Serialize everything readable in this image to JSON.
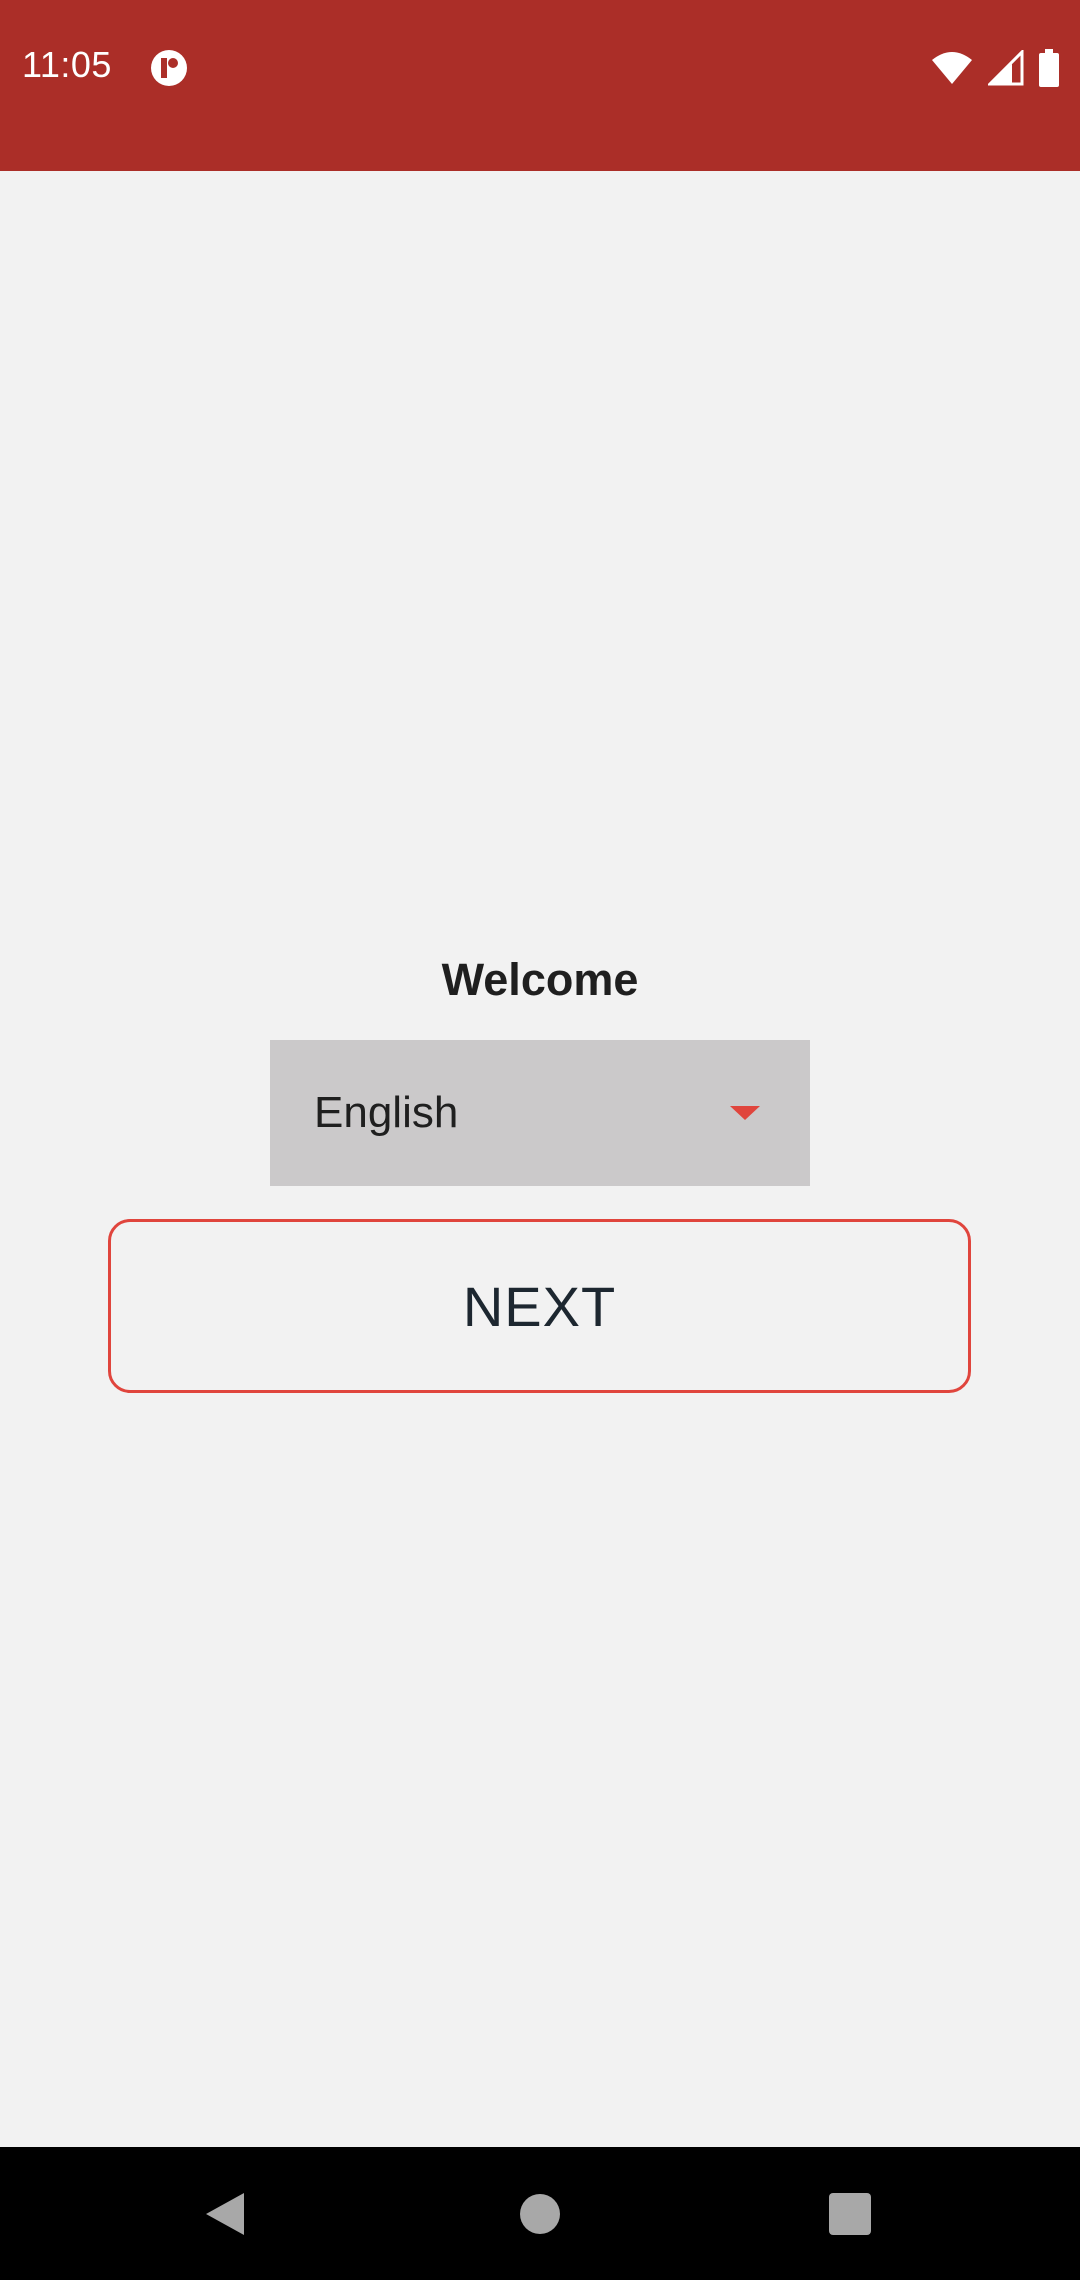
{
  "status_bar": {
    "time": "11:05",
    "app_icon": "app-notification-icon",
    "icons": [
      "wifi-icon",
      "cell-signal-icon",
      "battery-icon"
    ],
    "background_color": "#ab2e28"
  },
  "main": {
    "welcome_text": "Welcome",
    "language_select": {
      "selected_value": "English",
      "caret_icon": "dropdown-caret-icon"
    },
    "next_button_label": "NEXT",
    "accent_color": "#e0453d"
  },
  "nav_bar": {
    "buttons": [
      "back-icon",
      "home-icon",
      "recents-icon"
    ]
  }
}
